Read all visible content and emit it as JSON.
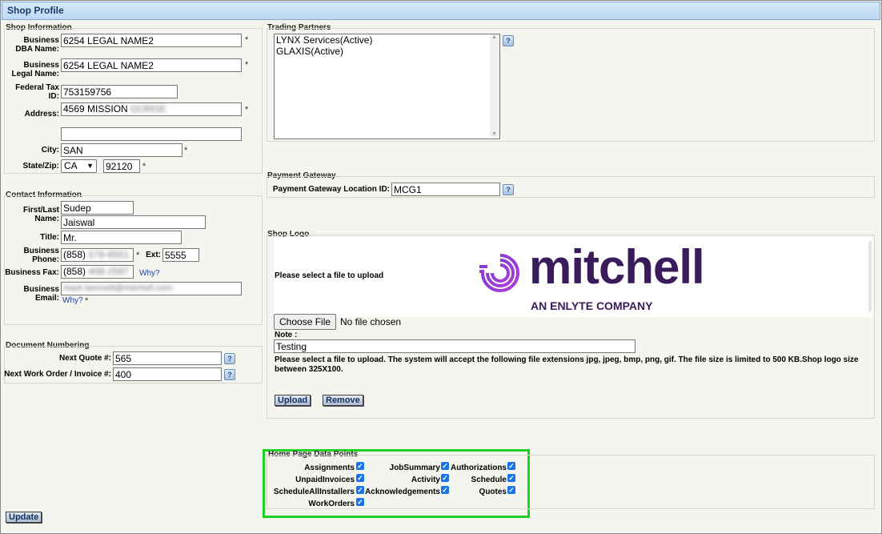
{
  "title": "Shop Profile",
  "shop_info": {
    "legend": "Shop Information",
    "dba_label": "Business DBA Name:",
    "dba_value": "6254 LEGAL NAME2",
    "legal_label": "Business Legal Name:",
    "legal_value": "6254 LEGAL NAME2",
    "tax_label": "Federal Tax ID:",
    "tax_value": "753159756",
    "address_label": "Address:",
    "address_value": "4569 MISSION",
    "address_blur": "GORGE",
    "address2_value": "",
    "city_label": "City:",
    "city_value": "SAN",
    "statezip_label": "State/Zip:",
    "state_value": "CA",
    "zip_value": "92120",
    "required_mark": "*"
  },
  "contact": {
    "legend": "Contact Information",
    "name_label": "First/Last Name:",
    "first_value": "Sudep",
    "last_value": "Jaiswal",
    "title_label": "Title:",
    "title_value": "Mr.",
    "phone_label": "Business Phone:",
    "phone_prefix": "(858)",
    "phone_blur": "578-6551",
    "ext_label": "Ext:",
    "ext_value": "5555",
    "fax_label": "Business Fax:",
    "fax_prefix": "(858)",
    "fax_blur": "408-2587",
    "why_link": "Why?",
    "email_label": "Business Email:",
    "email_blur": "mark.bennett@mitchell.com",
    "email_why": "Why?"
  },
  "doc_numbering": {
    "legend": "Document Numbering",
    "quote_label": "Next Quote #:",
    "quote_value": "565",
    "wo_label": "Next Work Order / Invoice #:",
    "wo_value": "400"
  },
  "trading": {
    "legend": "Trading Partners",
    "partners": [
      "LYNX Services(Active)",
      "GLAXIS(Active)"
    ]
  },
  "payment": {
    "legend": "Payment Gateway",
    "label": "Payment Gateway Location ID:",
    "value": "MCG1"
  },
  "logo": {
    "legend": "Shop Logo",
    "select_text": "Please select a file to upload",
    "brand_name": "mitchell",
    "brand_tag": "AN ENLYTE COMPANY",
    "choose_btn": "Choose File",
    "no_file": "No file chosen",
    "note_label": "Note :",
    "note_value": "Testing",
    "help_text": "Please select a file to upload. The system will accept the following file extensions jpg, jpeg, bmp, png, gif. The file size is limited to 500 KB.Shop logo size between 325X100.",
    "upload_btn": "Upload",
    "remove_btn": "Remove"
  },
  "datapoints": {
    "legend": "Home Page Data Points",
    "items": [
      {
        "label": "Assignments",
        "checked": true
      },
      {
        "label": "JobSummary",
        "checked": true
      },
      {
        "label": "Authorizations",
        "checked": true
      },
      {
        "label": "UnpaidInvoices",
        "checked": true
      },
      {
        "label": "Activity",
        "checked": true
      },
      {
        "label": "Schedule",
        "checked": true
      },
      {
        "label": "ScheduleAllInstallers",
        "checked": true
      },
      {
        "label": "Acknowledgements",
        "checked": true
      },
      {
        "label": "Quotes",
        "checked": true
      },
      {
        "label": "WorkOrders",
        "checked": true
      }
    ]
  },
  "update_btn": "Update",
  "colors": {
    "title_bg": "#c4ddf5",
    "highlight": "#21d321",
    "brand_purple": "#3b1c5a",
    "check_blue": "#1a73e8"
  }
}
